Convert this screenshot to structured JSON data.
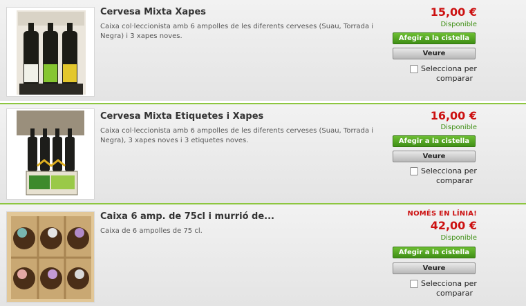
{
  "products": [
    {
      "title": "Cervesa Mixta Xapes",
      "description": "Caixa col·leccionista amb 6 ampolles de les diferents cerveses (Suau, Torrada i Negra) i 3 xapes noves.",
      "price": "15,00 €",
      "availability": "Disponible",
      "add_to_cart_label": "Afegir a la cistella",
      "view_label": "Veure",
      "compare_line1": "Selecciona per",
      "compare_line2": "comparar"
    },
    {
      "title": "Cervesa Mixta Etiquetes i Xapes",
      "description": "Caixa col·leccionista amb 6 ampolles de les diferents cerveses (Suau, Torrada i Negra), 3 xapes noves i 3 etiquetes noves.",
      "price": "16,00 €",
      "availability": "Disponible",
      "add_to_cart_label": "Afegir a la cistella",
      "view_label": "Veure",
      "compare_line1": "Selecciona per",
      "compare_line2": "comparar"
    },
    {
      "title": "Caixa 6 amp. de 75cl i murrió de...",
      "description": "Caixa de 6 ampolles de 75 cl.",
      "online_badge": "NOMÉS EN LÍNIA!",
      "price": "42,00 €",
      "availability": "Disponible",
      "add_to_cart_label": "Afegir a la cistella",
      "view_label": "Veure",
      "compare_line1": "Selecciona per",
      "compare_line2": "comparar"
    }
  ],
  "colors": {
    "separator": "#8dc63f",
    "price": "#cc1010",
    "availability": "#3c8e12",
    "cart_button": "#4f9f1e"
  }
}
